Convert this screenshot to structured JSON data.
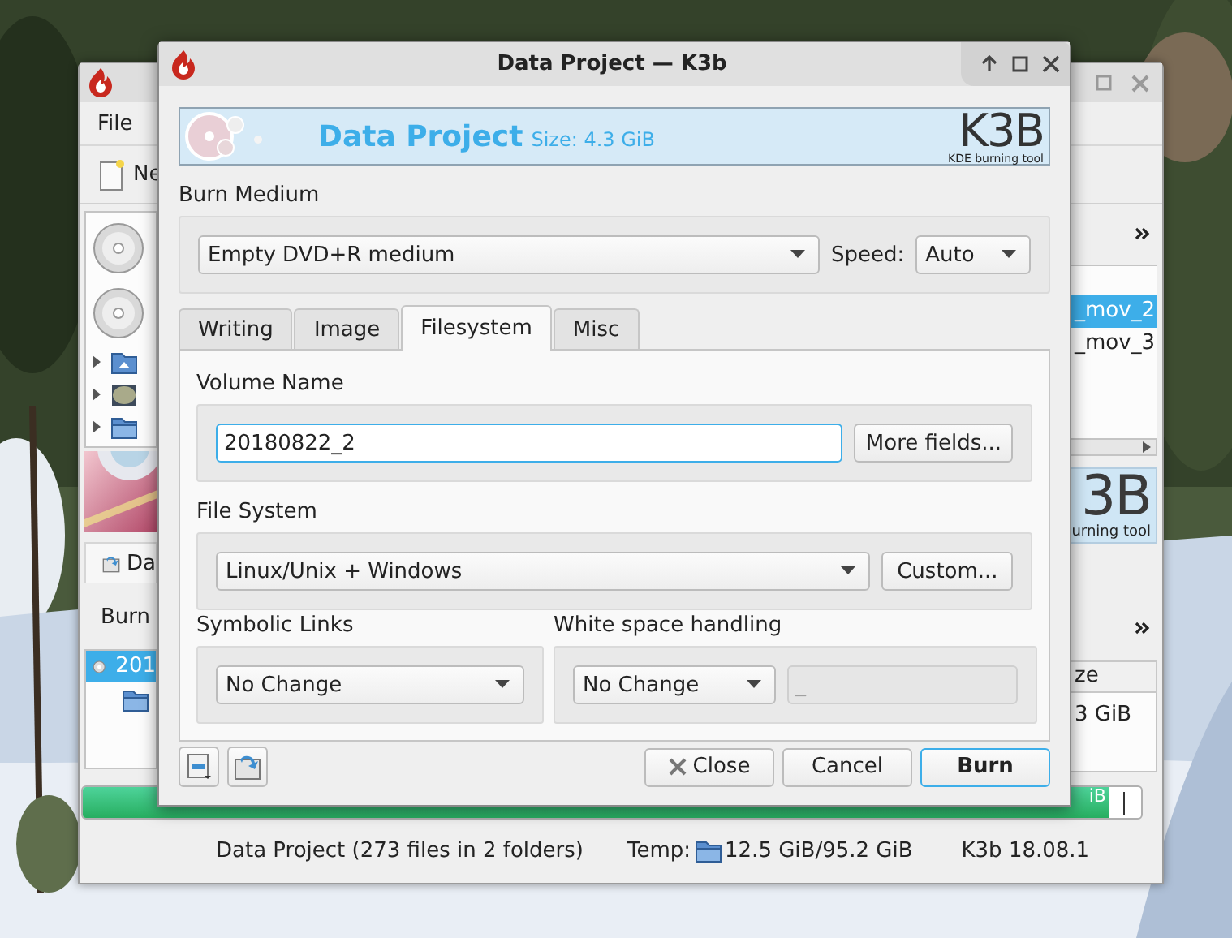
{
  "main_window": {
    "menu": [
      {
        "label": "File"
      }
    ],
    "toolbar": [
      {
        "label": "Ne"
      }
    ],
    "devices": [
      {
        "kind": "dvd"
      },
      {
        "kind": "dvd"
      }
    ],
    "tree": [
      {
        "kind": "home",
        "expanded": false
      },
      {
        "kind": "device",
        "expanded": false
      },
      {
        "kind": "folder",
        "expanded": false
      }
    ],
    "project_button": {
      "label": "Da"
    },
    "burn_label": "Burn",
    "project_tree": [
      {
        "label": "201",
        "selected": true,
        "children": [
          {
            "kind": "folder"
          }
        ]
      }
    ],
    "file_list": [
      {
        "label": "_mov_2",
        "selected": true
      },
      {
        "label": "_mov_3",
        "selected": false
      }
    ],
    "logo": {
      "text": "3B",
      "caption": "urning tool"
    },
    "size_column": "ze",
    "size_value": "3 GiB",
    "progress": {
      "level": 0.97,
      "label": "iB"
    },
    "status_bar": {
      "project": "Data Project (273 files in 2 folders)",
      "temp_label": "Temp:",
      "temp_value": "12.5 GiB/95.2 GiB",
      "version": "K3b 18.08.1"
    }
  },
  "dialog": {
    "title": "Data Project — K3b",
    "banner": {
      "title": "Data Project",
      "size": "Size: 4.3 GiB",
      "logo": "K3B",
      "logo_caption": "KDE burning tool"
    },
    "burn_medium": {
      "label": "Burn Medium",
      "device": "Empty DVD+R medium",
      "speed_label": "Speed:",
      "speed": "Auto"
    },
    "tabs": [
      {
        "label": "Writing",
        "selected": false
      },
      {
        "label": "Image",
        "selected": false
      },
      {
        "label": "Filesystem",
        "selected": true
      },
      {
        "label": "Misc",
        "selected": false
      }
    ],
    "volume_name": {
      "label": "Volume Name",
      "value": "20180822_2",
      "button": {
        "label": "More fields..."
      }
    },
    "file_system": {
      "label": "File System",
      "value": "Linux/Unix + Windows",
      "button": {
        "label": "Custom..."
      }
    },
    "symbolic_links": {
      "label": "Symbolic Links",
      "value": "No Change"
    },
    "white_space": {
      "label": "White space handling",
      "value": "No Change",
      "replacement": {
        "value": "_",
        "disabled": true
      }
    },
    "buttons": [
      {
        "label": "Close",
        "kind": "close",
        "default": false
      },
      {
        "label": "Cancel",
        "kind": "plain",
        "default": false
      },
      {
        "label": "Burn",
        "kind": "plain",
        "default": true
      }
    ]
  }
}
